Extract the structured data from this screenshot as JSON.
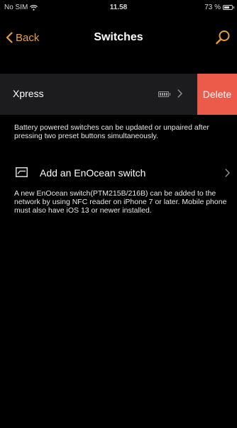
{
  "status_bar": {
    "carrier": "No SIM",
    "time": "11.58",
    "battery_percent": "73 %",
    "battery_level": 0.73
  },
  "nav": {
    "back_label": "Back",
    "title": "Switches"
  },
  "switch_row": {
    "name": "Xpress",
    "delete_label": "Delete"
  },
  "info_battery": "Battery powered switches can be updated or unpaired after pressing two preset buttons simultaneously.",
  "add_switch": {
    "label": "Add an EnOcean switch"
  },
  "info_enocean": "A new EnOcean switch(PTM215B/216B) can be added to the network by using NFC reader on iPhone 7 or later. Mobile phone must also have iOS 13 or newer installed.",
  "colors": {
    "accent": "#e6a03a",
    "delete": "#ec5a4a",
    "row_background": "#1c1c1e",
    "background": "#000000"
  },
  "icons": {
    "wifi": "wifi-icon",
    "battery": "battery-icon",
    "back": "chevron-left-icon",
    "search": "search-icon",
    "row_battery": "battery-icon",
    "chevron": "chevron-right-icon",
    "add": "switch-icon"
  }
}
